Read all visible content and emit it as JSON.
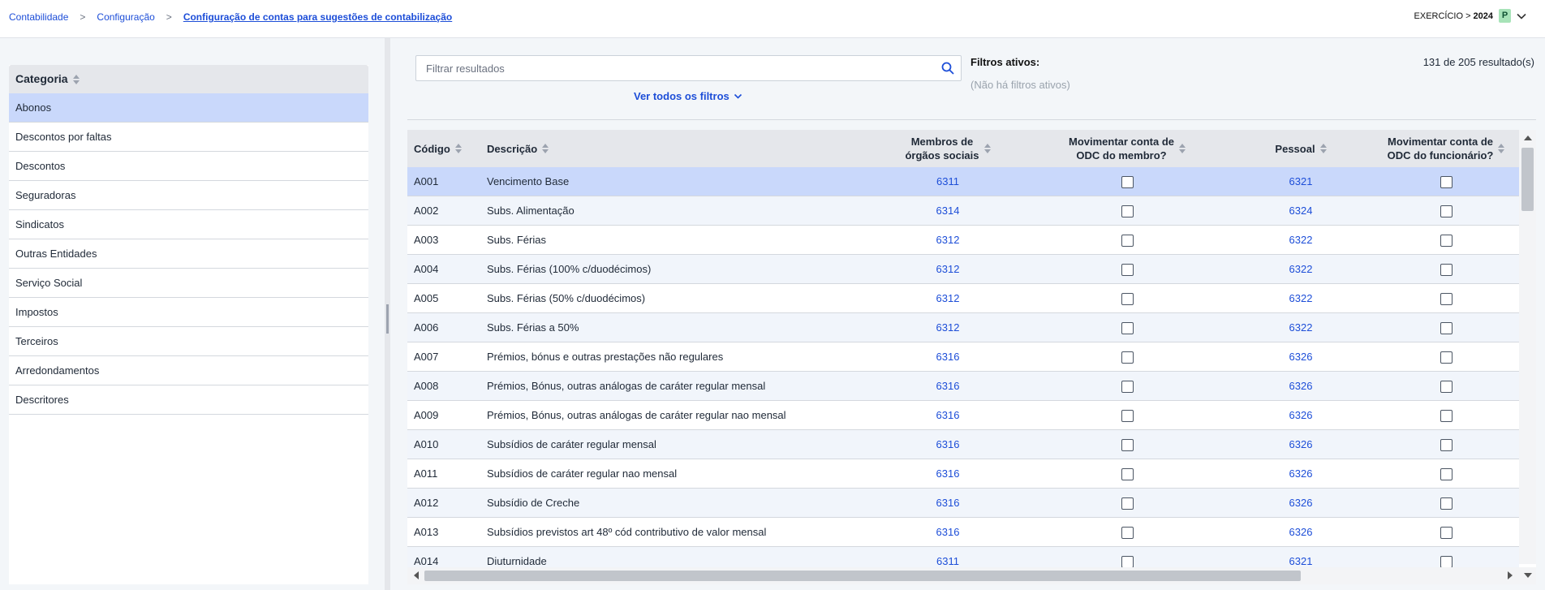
{
  "breadcrumb": {
    "items": [
      "Contabilidade",
      "Configuração",
      "Configuração de contas para sugestões de contabilização"
    ]
  },
  "exercicio": {
    "label": "EXERCÍCIO >",
    "year": "2024",
    "badge": "P"
  },
  "categories": {
    "header": "Categoria",
    "items": [
      "Abonos",
      "Descontos por faltas",
      "Descontos",
      "Seguradoras",
      "Sindicatos",
      "Outras Entidades",
      "Serviço Social",
      "Impostos",
      "Terceiros",
      "Arredondamentos",
      "Descritores"
    ],
    "selected": "Abonos"
  },
  "search": {
    "placeholder": "Filtrar resultados"
  },
  "filters": {
    "ver_todos": "Ver todos os filtros",
    "active_label": "Filtros ativos:",
    "none_text": "(Não há filtros ativos)"
  },
  "results_text": "131 de 205 resultado(s)",
  "table": {
    "headers": {
      "codigo": "Código",
      "descricao": "Descrição",
      "membros_l1": "Membros de",
      "membros_l2": "órgãos sociais",
      "mov_membro_l1": "Movimentar conta de",
      "mov_membro_l2": "ODC do membro?",
      "pessoal": "Pessoal",
      "mov_func_l1": "Movimentar conta de",
      "mov_func_l2": "ODC do funcionário?"
    },
    "rows": [
      {
        "codigo": "A001",
        "descricao": "Vencimento Base",
        "membros": "6311",
        "pessoal": "6321"
      },
      {
        "codigo": "A002",
        "descricao": "Subs. Alimentação",
        "membros": "6314",
        "pessoal": "6324"
      },
      {
        "codigo": "A003",
        "descricao": "Subs. Férias",
        "membros": "6312",
        "pessoal": "6322"
      },
      {
        "codigo": "A004",
        "descricao": "Subs. Férias (100% c/duodécimos)",
        "membros": "6312",
        "pessoal": "6322"
      },
      {
        "codigo": "A005",
        "descricao": "Subs. Férias (50% c/duodécimos)",
        "membros": "6312",
        "pessoal": "6322"
      },
      {
        "codigo": "A006",
        "descricao": "Subs. Férias a 50%",
        "membros": "6312",
        "pessoal": "6322"
      },
      {
        "codigo": "A007",
        "descricao": "Prémios, bónus e outras prestações não regulares",
        "membros": "6316",
        "pessoal": "6326"
      },
      {
        "codigo": "A008",
        "descricao": "Prémios, Bónus, outras análogas de caráter regular mensal",
        "membros": "6316",
        "pessoal": "6326"
      },
      {
        "codigo": "A009",
        "descricao": "Prémios, Bónus, outras análogas de caráter regular nao mensal",
        "membros": "6316",
        "pessoal": "6326"
      },
      {
        "codigo": "A010",
        "descricao": "Subsídios de caráter regular mensal",
        "membros": "6316",
        "pessoal": "6326"
      },
      {
        "codigo": "A011",
        "descricao": "Subsídios de caráter regular nao mensal",
        "membros": "6316",
        "pessoal": "6326"
      },
      {
        "codigo": "A012",
        "descricao": "Subsídio de Creche",
        "membros": "6316",
        "pessoal": "6326"
      },
      {
        "codigo": "A013",
        "descricao": "Subsídios previstos art 48º cód contributivo de valor mensal",
        "membros": "6316",
        "pessoal": "6326"
      },
      {
        "codigo": "A014",
        "descricao": "Diuturnidade",
        "membros": "6311",
        "pessoal": "6321"
      }
    ]
  }
}
